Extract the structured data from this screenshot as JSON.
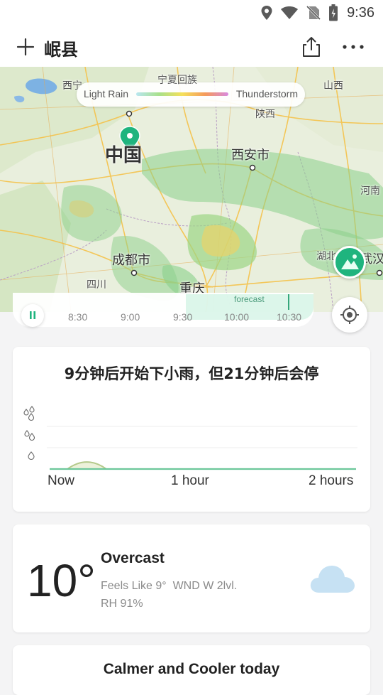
{
  "status_bar": {
    "time": "9:36",
    "icons": [
      "location-icon",
      "wifi-icon",
      "no-sim-icon",
      "battery-icon"
    ]
  },
  "header": {
    "city": "岷县",
    "add_icon": "plus-icon",
    "share_icon": "share-icon",
    "more_icon": "more-icon"
  },
  "map": {
    "legend": {
      "light": "Light Rain",
      "heavy": "Thunderstorm"
    },
    "labels": {
      "china": "中国",
      "xian": "西安市",
      "chengdu": "成都市",
      "chongqing": "重庆",
      "shaanxi": "陕西",
      "shanxi": "山西",
      "henan": "河南",
      "hubei": "湖北",
      "wuhan": "武汉",
      "sichuan": "四川",
      "xi_top": "西宁",
      "ningxia": "宁夏回族"
    },
    "forecast_label": "forecast",
    "ticks": [
      "8:30",
      "9:00",
      "9:30",
      "10:00",
      "10:30"
    ]
  },
  "precipitation": {
    "headline": "9分钟后开始下小雨，但21分钟后会停",
    "x_labels": [
      "Now",
      "1 hour",
      "2 hours"
    ]
  },
  "chart_data": {
    "type": "area",
    "x": [
      "Now",
      "1 hour",
      "2 hours"
    ],
    "series": [
      {
        "values": [
          0,
          0.6,
          0,
          0,
          0,
          0,
          0,
          0,
          0
        ]
      }
    ],
    "ylim": [
      0,
      3
    ]
  },
  "current": {
    "temperature": "10°",
    "condition": "Overcast",
    "feels_like": "Feels Like 9°",
    "wind": "WND W 2lvl.",
    "humidity": "RH 91%"
  },
  "summary": {
    "title": "Calmer and Cooler today"
  },
  "colors": {
    "accent": "#1fb47e",
    "rain_green": "#8bd08a",
    "cloud": "#c6e1f3"
  }
}
